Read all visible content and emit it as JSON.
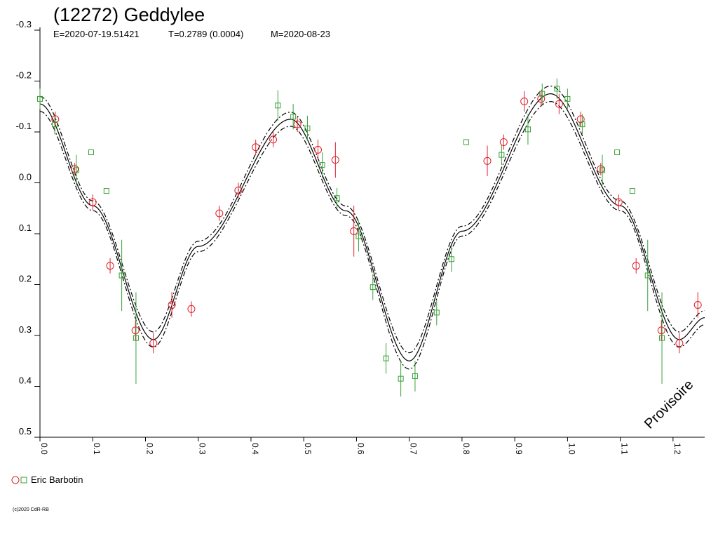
{
  "header": {
    "title": "(12272) Geddylee",
    "epoch": "E=2020-07-19.51421",
    "period": "T=0.2789 (0.0004)",
    "mean": "M=2020-08-23"
  },
  "legend": {
    "observer": "Eric Barbotin"
  },
  "watermark": "Provisoire",
  "copyright": "(c)2020 CdR-RB",
  "chart_data": {
    "type": "scatter",
    "title": "(12272) Geddylee",
    "xlim": [
      0.0,
      1.26
    ],
    "ylim": [
      -0.3,
      0.5
    ],
    "y_inverted": true,
    "grid": false,
    "legend_position": "bottom-left",
    "x_ticks": [
      "0.0",
      "0.1",
      "0.2",
      "0.3",
      "0.4",
      "0.5",
      "0.6",
      "0.7",
      "0.8",
      "0.9",
      "1.0",
      "1.1",
      "1.2"
    ],
    "y_ticks": [
      "-0.3",
      "-0.2",
      "-0.1",
      "0.0",
      "0.1",
      "0.2",
      "0.3",
      "0.4",
      "0.5"
    ],
    "colors": {
      "series_red": "#e0202a",
      "series_green": "#3aa03a",
      "curve": "#000000"
    },
    "series": [
      {
        "name": "Eric Barbotin",
        "marker": "circle",
        "color": "#e0202a",
        "points": [
          {
            "x": 0.029,
            "y": -0.125,
            "err": 0.015
          },
          {
            "x": 0.066,
            "y": -0.027,
            "err": 0.012
          },
          {
            "x": 0.1,
            "y": 0.038,
            "err": 0.015
          },
          {
            "x": 0.133,
            "y": 0.163,
            "err": 0.015
          },
          {
            "x": 0.181,
            "y": 0.29,
            "err": 0.02
          },
          {
            "x": 0.215,
            "y": 0.315,
            "err": 0.02
          },
          {
            "x": 0.25,
            "y": 0.24,
            "err": 0.025
          },
          {
            "x": 0.287,
            "y": 0.248,
            "err": 0.015
          },
          {
            "x": 0.34,
            "y": 0.06,
            "err": 0.015
          },
          {
            "x": 0.376,
            "y": 0.015,
            "err": 0.015
          },
          {
            "x": 0.409,
            "y": -0.07,
            "err": 0.015
          },
          {
            "x": 0.442,
            "y": -0.085,
            "err": 0.015
          },
          {
            "x": 0.488,
            "y": -0.115,
            "err": 0.015
          },
          {
            "x": 0.527,
            "y": -0.065,
            "err": 0.02
          },
          {
            "x": 0.56,
            "y": -0.045,
            "err": 0.035
          },
          {
            "x": 0.595,
            "y": 0.095,
            "err": 0.05
          },
          {
            "x": 0.848,
            "y": -0.043,
            "err": 0.03
          },
          {
            "x": 0.879,
            "y": -0.08,
            "err": 0.015
          },
          {
            "x": 0.918,
            "y": -0.16,
            "err": 0.02
          },
          {
            "x": 0.95,
            "y": -0.165,
            "err": 0.015
          },
          {
            "x": 0.984,
            "y": -0.155,
            "err": 0.02
          },
          {
            "x": 1.025,
            "y": -0.125,
            "err": 0.015
          },
          {
            "x": 1.063,
            "y": -0.027,
            "err": 0.012
          },
          {
            "x": 1.097,
            "y": 0.038,
            "err": 0.015
          },
          {
            "x": 1.13,
            "y": 0.163,
            "err": 0.015
          },
          {
            "x": 1.178,
            "y": 0.29,
            "err": 0.02
          },
          {
            "x": 1.212,
            "y": 0.315,
            "err": 0.02
          },
          {
            "x": 1.247,
            "y": 0.24,
            "err": 0.025
          }
        ]
      },
      {
        "name": "Eric Barbotin",
        "marker": "square",
        "color": "#3aa03a",
        "points": [
          {
            "x": 0.0,
            "y": -0.165,
            "err": 0.02
          },
          {
            "x": 0.028,
            "y": -0.115,
            "err": 0.02
          },
          {
            "x": 0.069,
            "y": -0.025,
            "err": 0.03
          },
          {
            "x": 0.097,
            "y": -0.06,
            "err": 0.0
          },
          {
            "x": 0.126,
            "y": 0.016,
            "err": 0.0
          },
          {
            "x": 0.155,
            "y": 0.182,
            "err": 0.07
          },
          {
            "x": 0.182,
            "y": 0.305,
            "err": 0.09
          },
          {
            "x": 0.451,
            "y": -0.152,
            "err": 0.03
          },
          {
            "x": 0.48,
            "y": -0.13,
            "err": 0.025
          },
          {
            "x": 0.507,
            "y": -0.107,
            "err": 0.025
          },
          {
            "x": 0.535,
            "y": -0.035,
            "err": 0.025
          },
          {
            "x": 0.563,
            "y": 0.03,
            "err": 0.02
          },
          {
            "x": 0.604,
            "y": 0.105,
            "err": 0.03
          },
          {
            "x": 0.631,
            "y": 0.205,
            "err": 0.025
          },
          {
            "x": 0.656,
            "y": 0.345,
            "err": 0.03
          },
          {
            "x": 0.684,
            "y": 0.385,
            "err": 0.035
          },
          {
            "x": 0.711,
            "y": 0.38,
            "err": 0.03
          },
          {
            "x": 0.752,
            "y": 0.255,
            "err": 0.025
          },
          {
            "x": 0.78,
            "y": 0.15,
            "err": 0.025
          },
          {
            "x": 0.808,
            "y": -0.08,
            "err": 0.0
          },
          {
            "x": 0.875,
            "y": -0.055,
            "err": 0.02
          },
          {
            "x": 0.925,
            "y": -0.105,
            "err": 0.03
          },
          {
            "x": 0.952,
            "y": -0.175,
            "err": 0.02
          },
          {
            "x": 0.98,
            "y": -0.185,
            "err": 0.02
          },
          {
            "x": 1.0,
            "y": -0.165,
            "err": 0.02
          },
          {
            "x": 1.028,
            "y": -0.115,
            "err": 0.02
          },
          {
            "x": 1.066,
            "y": -0.025,
            "err": 0.03
          },
          {
            "x": 1.094,
            "y": -0.06,
            "err": 0.0
          },
          {
            "x": 1.123,
            "y": 0.016,
            "err": 0.0
          },
          {
            "x": 1.152,
            "y": 0.182,
            "err": 0.07
          },
          {
            "x": 1.179,
            "y": 0.305,
            "err": 0.09
          }
        ]
      }
    ],
    "fit_curve": {
      "anchors": [
        {
          "x": 0.0,
          "y": -0.155
        },
        {
          "x": 0.1,
          "y": 0.045
        },
        {
          "x": 0.215,
          "y": 0.308
        },
        {
          "x": 0.3,
          "y": 0.125
        },
        {
          "x": 0.475,
          "y": -0.125
        },
        {
          "x": 0.58,
          "y": 0.055
        },
        {
          "x": 0.7,
          "y": 0.35
        },
        {
          "x": 0.8,
          "y": 0.095
        },
        {
          "x": 0.968,
          "y": -0.175
        },
        {
          "x": 1.1,
          "y": 0.045
        },
        {
          "x": 1.212,
          "y": 0.308
        },
        {
          "x": 1.26,
          "y": 0.265
        }
      ],
      "band": 0.015
    }
  }
}
